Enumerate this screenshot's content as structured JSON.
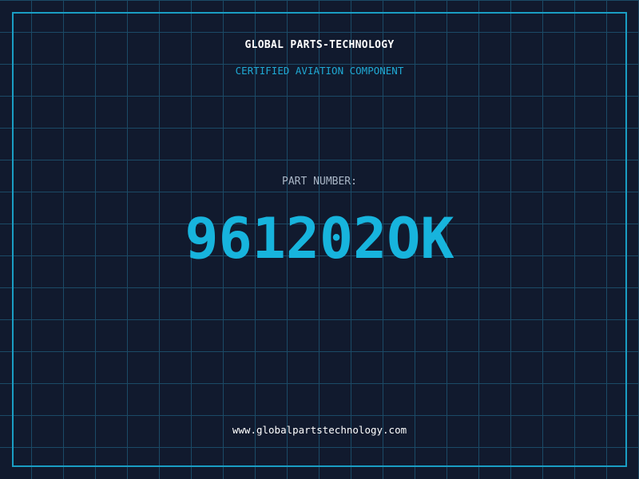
{
  "header": {
    "company_name": "GLOBAL PARTS-TECHNOLOGY",
    "subtitle": "CERTIFIED AVIATION COMPONENT"
  },
  "part": {
    "label": "PART NUMBER:",
    "number": "961202OK"
  },
  "footer": {
    "website": "www.globalpartstechnology.com"
  },
  "colors": {
    "background": "#111a2e",
    "grid_lines": "#1b4a66",
    "frame": "#1a9ec4",
    "accent": "#17b4dd",
    "label_text": "#aab6c6",
    "primary_text": "#ffffff"
  }
}
